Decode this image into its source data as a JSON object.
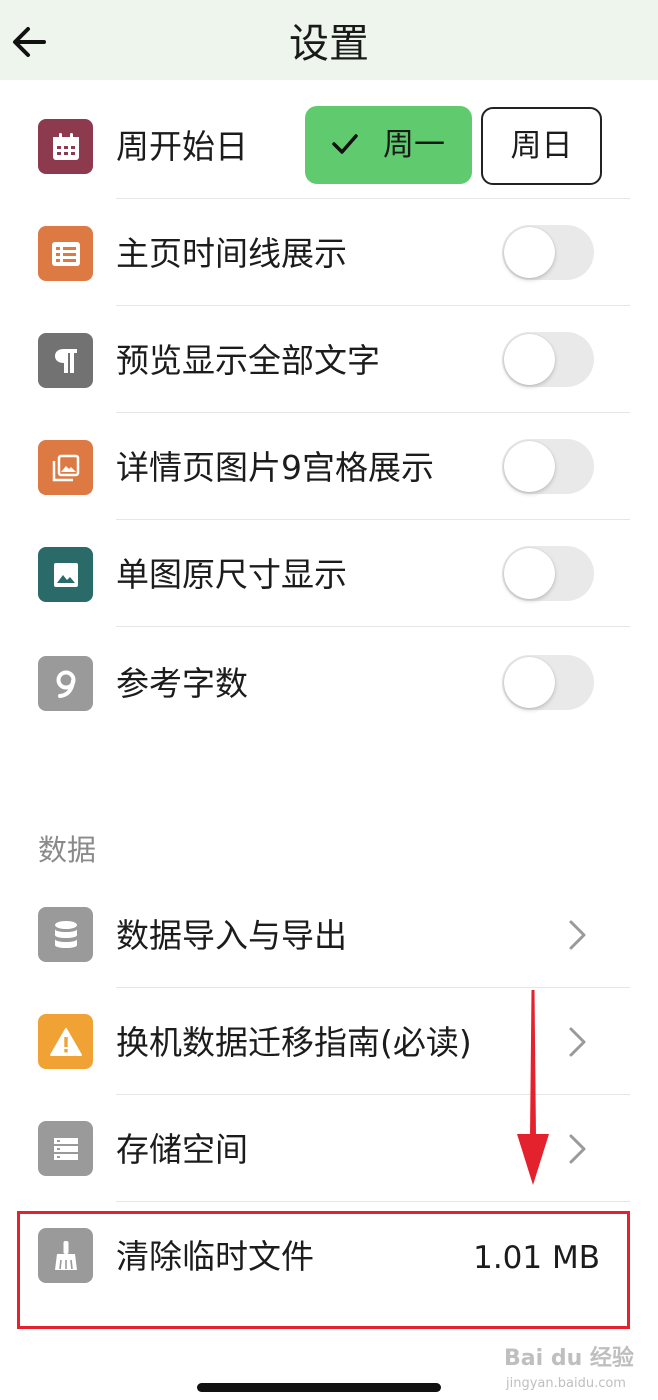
{
  "header": {
    "title": "设置"
  },
  "settings": [
    {
      "label": "周开始日",
      "icon": "calendar-icon",
      "color": "#8e3a4e"
    },
    {
      "label": "主页时间线展示",
      "icon": "list-icon",
      "color": "#dd7a44",
      "toggle": false
    },
    {
      "label": "预览显示全部文字",
      "icon": "paragraph-icon",
      "color": "#727272",
      "toggle": false
    },
    {
      "label": "详情页图片9宫格展示",
      "icon": "gallery-icon",
      "color": "#dd7a44",
      "toggle": false
    },
    {
      "label": "单图原尺寸显示",
      "icon": "image-icon",
      "color": "#2a6b6a",
      "toggle": false
    },
    {
      "label": "参考字数",
      "icon": "number-nine-icon",
      "color": "#9a9a9a",
      "toggle": false
    }
  ],
  "week_start": {
    "monday_label": "周一",
    "sunday_label": "周日",
    "selected": "周一"
  },
  "data_section": {
    "title": "数据",
    "items": [
      {
        "label": "数据导入与导出",
        "icon": "database-icon",
        "color": "#9a9a9a"
      },
      {
        "label": "换机数据迁移指南(必读)",
        "icon": "warning-icon",
        "color": "#f1a234"
      },
      {
        "label": "存储空间",
        "icon": "storage-icon",
        "color": "#9a9a9a"
      },
      {
        "label": "清除临时文件",
        "icon": "broom-icon",
        "color": "#9a9a9a",
        "value": "1.01 MB"
      }
    ]
  },
  "annotation": {
    "color": "#e3222e"
  },
  "watermark": {
    "text": "Bai du 经验",
    "sub": "jingyan.baidu.com"
  },
  "colors": {
    "header_bg": "#eef5ed",
    "accent_green": "#5fcb6e"
  }
}
